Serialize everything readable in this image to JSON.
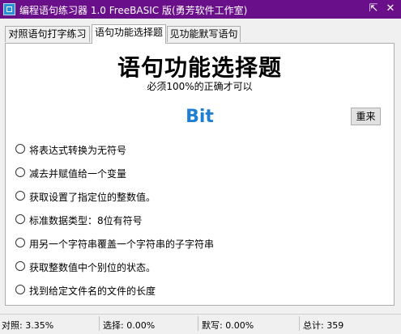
{
  "window": {
    "title": "编程语句练习器 1.0 FreeBASIC 版(勇芳软件工作室)",
    "pin_glyph": "⇱",
    "close_glyph": "✕"
  },
  "tabs": [
    {
      "label": "对照语句打字练习"
    },
    {
      "label": "语句功能选择题"
    },
    {
      "label": "见功能默写语句"
    }
  ],
  "main": {
    "heading": "语句功能选择题",
    "subheading": "必须100%的正确才可以",
    "word": "Bit",
    "reset_label": "重来",
    "options": [
      {
        "label": "将表达式转换为无符号"
      },
      {
        "label": "减去并赋值给一个变量"
      },
      {
        "label": "获取设置了指定位的整数值。"
      },
      {
        "label": "标准数据类型：8位有符号"
      },
      {
        "label": "用另一个字符串覆盖一个字符串的子字符串"
      },
      {
        "label": "获取整数值中个别位的状态。"
      },
      {
        "label": "找到给定文件名的文件的长度"
      }
    ]
  },
  "status": {
    "duizhao": "对照: 3.35%",
    "xuanze": "选择: 0.00%",
    "moxie": "默写: 0.00%",
    "zongji": "总计: 359"
  }
}
